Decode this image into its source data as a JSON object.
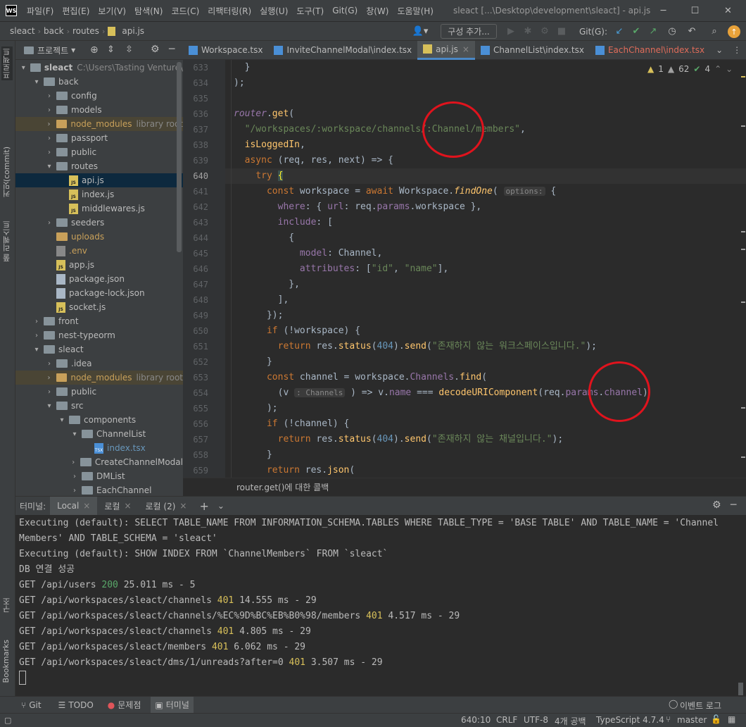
{
  "menubar": {
    "logo": "WS",
    "items": [
      "파일(F)",
      "편집(E)",
      "보기(V)",
      "탐색(N)",
      "코드(C)",
      "리팩터링(R)",
      "실행(U)",
      "도구(T)",
      "Git(G)",
      "창(W)",
      "도움말(H)"
    ],
    "window_title": "sleact [...\\Desktop\\development\\sleact] - api.js",
    "minimize": "─",
    "maximize": "☐",
    "close": "✕"
  },
  "navbar": {
    "crumbs": [
      "sleact",
      "back",
      "routes",
      "api.js"
    ],
    "config_button": "구성 추가...",
    "git_label": "Git(G):"
  },
  "left_stripe": {
    "project": "프로젝트",
    "commit": "커밋(commit)",
    "pull_requests": "풀 리퀘스트",
    "structure": "구조",
    "bookmarks": "Bookmarks"
  },
  "project_panel": {
    "title": "프로젝트",
    "tree": [
      {
        "depth": 0,
        "arrow": "▾",
        "type": "folder",
        "label": "sleact",
        "extra": "C:\\Users\\Tasting Venture\\"
      },
      {
        "depth": 1,
        "arrow": "▾",
        "type": "folder",
        "label": "back"
      },
      {
        "depth": 2,
        "arrow": "›",
        "type": "folder",
        "label": "config"
      },
      {
        "depth": 2,
        "arrow": "›",
        "type": "folder",
        "label": "models"
      },
      {
        "depth": 2,
        "arrow": "›",
        "type": "lib",
        "label": "node_modules",
        "extra": "library root"
      },
      {
        "depth": 2,
        "arrow": "›",
        "type": "folder",
        "label": "passport"
      },
      {
        "depth": 2,
        "arrow": "›",
        "type": "folder",
        "label": "public"
      },
      {
        "depth": 2,
        "arrow": "▾",
        "type": "folder",
        "label": "routes"
      },
      {
        "depth": 3,
        "arrow": "",
        "type": "js",
        "label": "api.js",
        "selected": true
      },
      {
        "depth": 3,
        "arrow": "",
        "type": "js",
        "label": "index.js"
      },
      {
        "depth": 3,
        "arrow": "",
        "type": "js",
        "label": "middlewares.js"
      },
      {
        "depth": 2,
        "arrow": "›",
        "type": "folder",
        "label": "seeders"
      },
      {
        "depth": 2,
        "arrow": "",
        "type": "folder-y",
        "label": "uploads"
      },
      {
        "depth": 2,
        "arrow": "",
        "type": "env",
        "label": ".env"
      },
      {
        "depth": 2,
        "arrow": "",
        "type": "js",
        "label": "app.js"
      },
      {
        "depth": 2,
        "arrow": "",
        "type": "json",
        "label": "package.json"
      },
      {
        "depth": 2,
        "arrow": "",
        "type": "json",
        "label": "package-lock.json"
      },
      {
        "depth": 2,
        "arrow": "",
        "type": "js",
        "label": "socket.js"
      },
      {
        "depth": 1,
        "arrow": "›",
        "type": "folder",
        "label": "front"
      },
      {
        "depth": 1,
        "arrow": "›",
        "type": "folder",
        "label": "nest-typeorm"
      },
      {
        "depth": 1,
        "arrow": "▾",
        "type": "folder",
        "label": "sleact"
      },
      {
        "depth": 2,
        "arrow": "›",
        "type": "folder",
        "label": ".idea"
      },
      {
        "depth": 2,
        "arrow": "›",
        "type": "lib",
        "label": "node_modules",
        "extra": "library root"
      },
      {
        "depth": 2,
        "arrow": "›",
        "type": "folder",
        "label": "public"
      },
      {
        "depth": 2,
        "arrow": "▾",
        "type": "folder",
        "label": "src"
      },
      {
        "depth": 3,
        "arrow": "▾",
        "type": "folder",
        "label": "components"
      },
      {
        "depth": 4,
        "arrow": "▾",
        "type": "folder",
        "label": "ChannelList"
      },
      {
        "depth": 5,
        "arrow": "",
        "type": "tsx",
        "label": "index.tsx",
        "blue": true
      },
      {
        "depth": 4,
        "arrow": "›",
        "type": "folder",
        "label": "CreateChannelModal"
      },
      {
        "depth": 4,
        "arrow": "›",
        "type": "folder",
        "label": "DMList"
      },
      {
        "depth": 4,
        "arrow": "›",
        "type": "folder",
        "label": "EachChannel"
      }
    ]
  },
  "editor": {
    "tabs": [
      {
        "label": "Workspace.tsx",
        "color": "#4a8fd6"
      },
      {
        "label": "InviteChannelModal\\index.tsx",
        "color": "#4a8fd6"
      },
      {
        "label": "api.js",
        "color": "#4a8fd6",
        "active": true
      },
      {
        "label": "ChannelList\\index.tsx",
        "color": "#4a8fd6"
      },
      {
        "label": "EachChannel\\index.tsx",
        "color": "#e06c5a"
      }
    ],
    "inspections": {
      "warnings": "1",
      "weak": "62",
      "ok": "4"
    },
    "line_numbers": [
      "633",
      "634",
      "635",
      "636",
      "637",
      "638",
      "639",
      "640",
      "641",
      "642",
      "643",
      "644",
      "645",
      "646",
      "647",
      "648",
      "649",
      "650",
      "651",
      "652",
      "653",
      "654",
      "655",
      "656",
      "657",
      "658",
      "659"
    ],
    "code_breadcrumb": "router.get()에 대한 콜백"
  },
  "terminal": {
    "title": "터미널:",
    "tabs": [
      "Local",
      "로컬",
      "로컬 (2)"
    ],
    "lines": [
      "Executing (default): SELECT TABLE_NAME FROM INFORMATION_SCHEMA.TABLES WHERE TABLE_TYPE = 'BASE TABLE' AND TABLE_NAME = 'Channel",
      "Members' AND TABLE_SCHEMA = 'sleact'",
      "Executing (default): SHOW INDEX FROM `ChannelMembers` FROM `sleact`",
      "DB 연결 성공"
    ],
    "requests": [
      {
        "path": "GET /api/users ",
        "status": "200",
        "rest": " 25.011 ms - 5"
      },
      {
        "path": "GET /api/workspaces/sleact/channels ",
        "status": "401",
        "rest": " 14.555 ms - 29"
      },
      {
        "path": "GET /api/workspaces/sleact/channels/%EC%9D%BC%EB%B0%98/members ",
        "status": "401",
        "rest": " 4.517 ms - 29"
      },
      {
        "path": "GET /api/workspaces/sleact/channels ",
        "status": "401",
        "rest": " 4.805 ms - 29"
      },
      {
        "path": "GET /api/workspaces/sleact/members ",
        "status": "401",
        "rest": " 6.062 ms - 29"
      },
      {
        "path": "GET /api/workspaces/sleact/dms/1/unreads?after=0 ",
        "status": "401",
        "rest": " 3.507 ms - 29"
      }
    ]
  },
  "bottom_tools": {
    "git": "Git",
    "todo": "TODO",
    "problems": "문제점",
    "terminal": "터미널",
    "event_log": "이벤트 로그"
  },
  "status": {
    "position": "640:10",
    "line_sep": "CRLF",
    "encoding": "UTF-8",
    "indent": "4개 공백",
    "language": "TypeScript 4.7.4",
    "branch": "master"
  },
  "colors": {
    "accent": "#4a88c7",
    "annotation": "#e0131d",
    "status_ok": "#59a869",
    "status_warn": "#d8c05a"
  }
}
